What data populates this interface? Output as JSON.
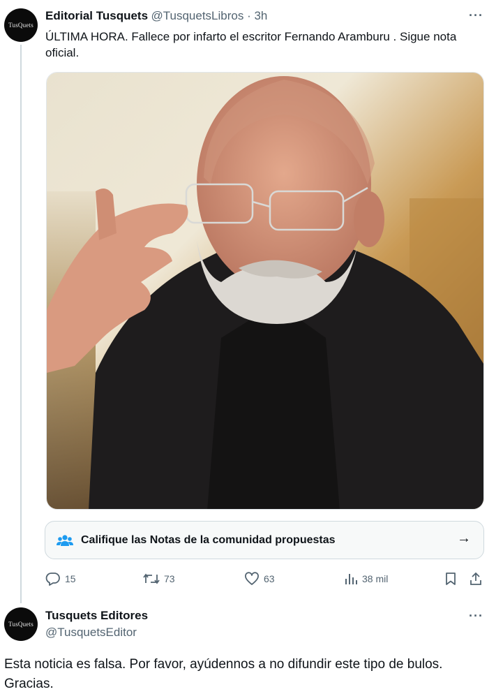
{
  "tweet1": {
    "avatar_text": "TusQuets",
    "name": "Editorial Tusquets",
    "handle": "@TusquetsLibros · 3h",
    "more": "···",
    "text": "ÚLTIMA HORA. Fallece por infarto el escritor Fernando Aramburu . Sigue nota oficial.",
    "community_note": {
      "label": "Califique las Notas de la comunidad propuestas",
      "arrow": "→"
    },
    "actions": {
      "replies": "15",
      "reposts": "73",
      "likes": "63",
      "views": "38 mil"
    },
    "icons": [
      "community-notes-icon",
      "arrow-right-icon",
      "reply-icon",
      "repost-icon",
      "like-icon",
      "views-icon",
      "bookmark-icon",
      "share-icon",
      "more-icon"
    ]
  },
  "tweet2": {
    "avatar_text": "TusQuets",
    "name": "Tusquets Editores",
    "handle": "@TusquetsEditor",
    "more": "···",
    "text": "Esta noticia es falsa. Por favor, ayúdennos a no difundir este tipo de bulos. Gracias."
  },
  "colors": {
    "text": "#0f1419",
    "secondary": "#536471",
    "border": "#cfd9de",
    "community_blue": "#1d9bf0"
  }
}
